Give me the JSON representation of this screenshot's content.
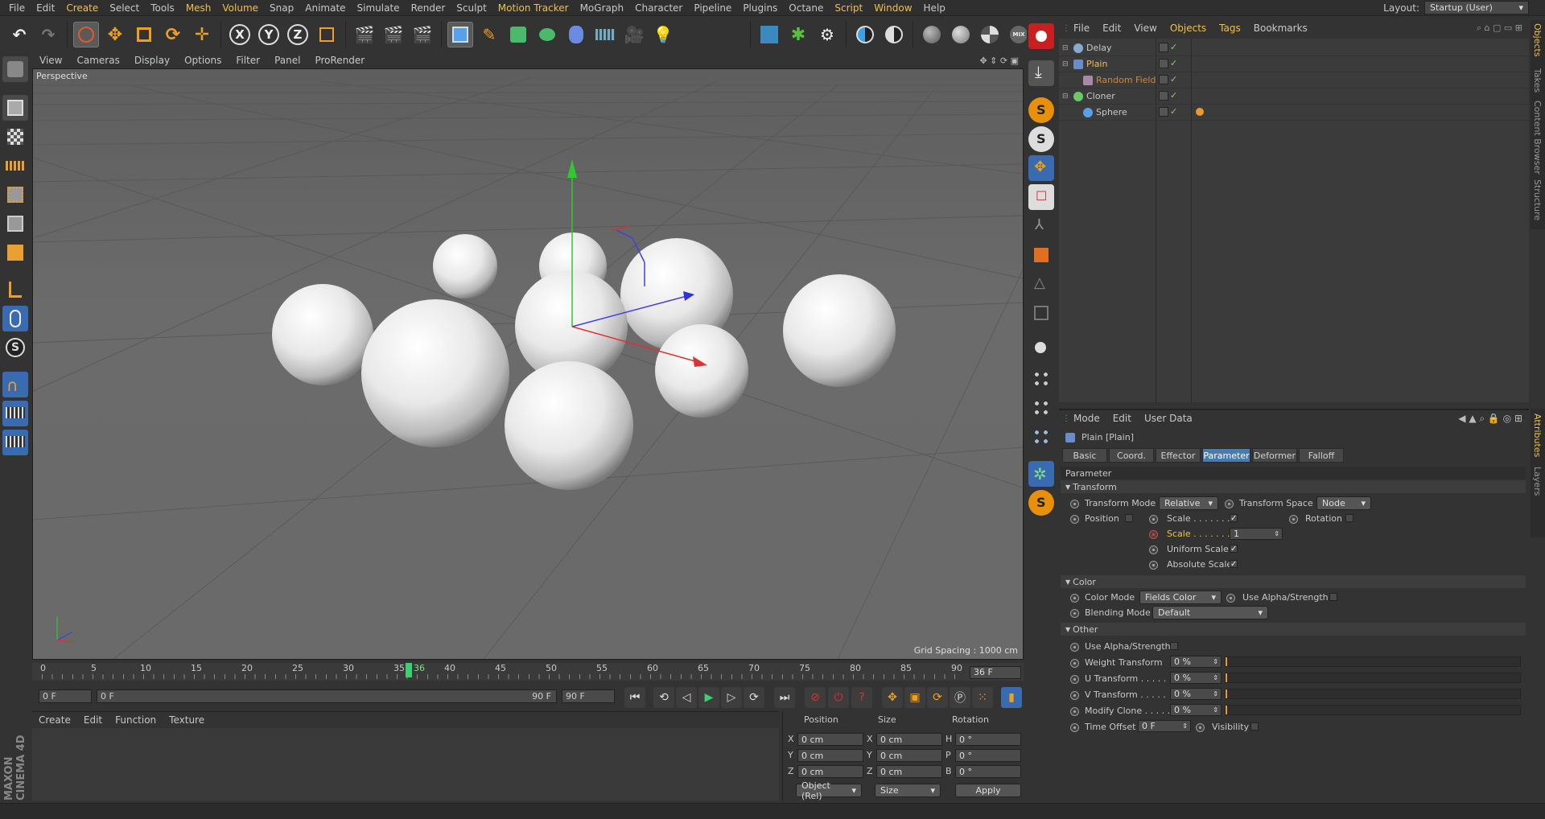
{
  "menu": [
    "File",
    "Edit",
    "Create",
    "Select",
    "Tools",
    "Mesh",
    "Volume",
    "Snap",
    "Animate",
    "Simulate",
    "Render",
    "Sculpt",
    "Motion Tracker",
    "MoGraph",
    "Character",
    "Pipeline",
    "Plugins",
    "Octane",
    "Script",
    "Window",
    "Help"
  ],
  "menu_highlight": [
    "Create",
    "Mesh",
    "Volume",
    "Motion Tracker",
    "Script",
    "Window"
  ],
  "layout_label": "Layout:",
  "layout_value": "Startup (User)",
  "axis": {
    "x": "X",
    "y": "Y",
    "z": "Z"
  },
  "viewport": {
    "menu": [
      "View",
      "Cameras",
      "Display",
      "Options",
      "Filter",
      "Panel",
      "ProRender"
    ],
    "label": "Perspective",
    "grid_spacing": "Grid Spacing : 1000 cm"
  },
  "timeline": {
    "ticks": [
      "0",
      "5",
      "10",
      "15",
      "20",
      "25",
      "30",
      "35",
      "40",
      "45",
      "50",
      "55",
      "60",
      "65",
      "70",
      "75",
      "80",
      "85",
      "90"
    ],
    "current_marker": "36",
    "frame_field": "36 F",
    "min_frame": "0 F",
    "range_start": "0 F",
    "range_end": "90 F",
    "max_frame": "90 F"
  },
  "material_menu": [
    "Create",
    "Edit",
    "Function",
    "Texture"
  ],
  "brand": "MAXON CINEMA 4D",
  "coord": {
    "headers": [
      "Position",
      "Size",
      "Rotation"
    ],
    "rows": [
      {
        "pl": "X",
        "pv": "0 cm",
        "sl": "X",
        "sv": "0 cm",
        "rl": "H",
        "rv": "0 °"
      },
      {
        "pl": "Y",
        "pv": "0 cm",
        "sl": "Y",
        "sv": "0 cm",
        "rl": "P",
        "rv": "0 °"
      },
      {
        "pl": "Z",
        "pv": "0 cm",
        "sl": "Z",
        "sv": "0 cm",
        "rl": "B",
        "rv": "0 °"
      }
    ],
    "mode_dropdown": "Object (Rel)",
    "size_dropdown": "Size",
    "apply": "Apply"
  },
  "objects_menu": [
    "File",
    "Edit",
    "View",
    "Objects",
    "Tags",
    "Bookmarks"
  ],
  "objects": [
    {
      "name": "Delay",
      "indent": 0,
      "color": "#c8c8c8"
    },
    {
      "name": "Plain",
      "indent": 0,
      "color": "#f0c04a"
    },
    {
      "name": "Random Field",
      "indent": 2,
      "color": "#d08a3a"
    },
    {
      "name": "Cloner",
      "indent": 0,
      "color": "#c8c8c8"
    },
    {
      "name": "Sphere",
      "indent": 1,
      "color": "#c8c8c8"
    }
  ],
  "attributes": {
    "menu": [
      "Mode",
      "Edit",
      "User Data"
    ],
    "title": "Plain [Plain]",
    "tabs": [
      "Basic",
      "Coord.",
      "Effector",
      "Parameter",
      "Deformer",
      "Falloff"
    ],
    "active_tab": "Parameter",
    "parameter_header": "Parameter",
    "transform_section": "Transform",
    "transform_mode_label": "Transform Mode",
    "transform_mode_value": "Relative",
    "transform_space_label": "Transform Space",
    "transform_space_value": "Node",
    "position_label": "Position",
    "scale_check_label": "Scale . . . . . . . .",
    "rotation_label": "Rotation",
    "scale_value_label": "Scale . . . . . . . .",
    "scale_value": "1",
    "uniform_scale_label": "Uniform Scale",
    "absolute_scale_label": "Absolute Scale",
    "color_section": "Color",
    "color_mode_label": "Color Mode",
    "color_mode_value": "Fields Color",
    "use_alpha_label": "Use Alpha/Strength",
    "blending_mode_label": "Blending Mode",
    "blending_mode_value": "Default",
    "other_section": "Other",
    "other_use_alpha_label": "Use Alpha/Strength",
    "weight_label": "Weight Transform",
    "weight_value": "0 %",
    "u_label": "U Transform . . . . .",
    "u_value": "0 %",
    "v_label": "V Transform . . . . .",
    "v_value": "0 %",
    "modify_label": "Modify Clone . . . . .",
    "modify_value": "0 %",
    "time_offset_label": "Time Offset",
    "time_offset_value": "0 F",
    "visibility_label": "Visibility"
  },
  "side_tabs_top": [
    "Objects",
    "Takes",
    "Content Browser",
    "Structure"
  ],
  "side_tabs_bottom": [
    "Attributes",
    "Layers"
  ]
}
